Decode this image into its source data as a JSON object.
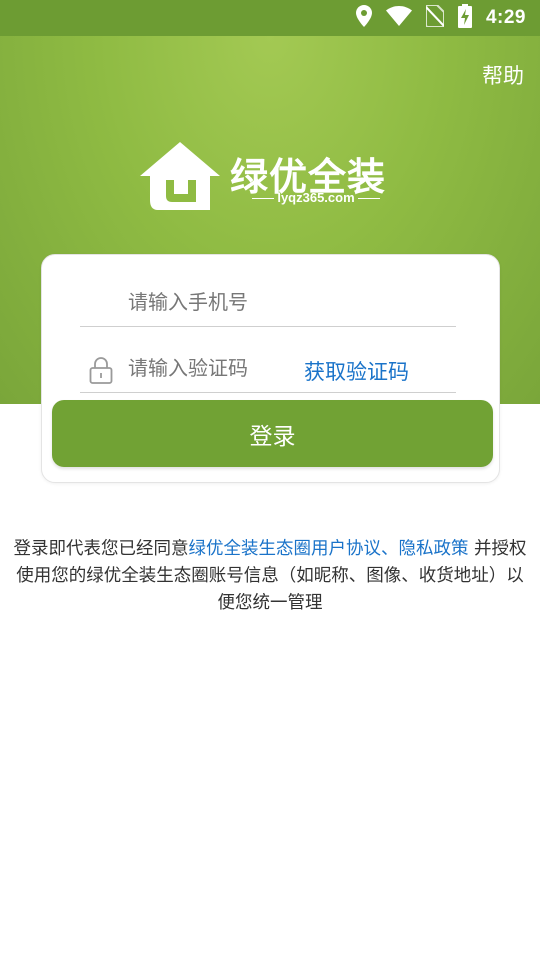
{
  "status_bar": {
    "time": "4:29",
    "icons": [
      "location-icon",
      "wifi-icon",
      "no-sim-icon",
      "battery-charging-icon"
    ]
  },
  "header": {
    "help_label": "帮助"
  },
  "logo": {
    "brand_name": "绿优全装",
    "domain": "lyqz365.com"
  },
  "form": {
    "phone_placeholder": "请输入手机号",
    "code_placeholder": "请输入验证码",
    "get_code_label": "获取验证码",
    "login_label": "登录"
  },
  "agreement": {
    "prefix": "登录即代表您已经同意",
    "user_agreement_link": "绿优全装生态圈用户协议",
    "separator": "、",
    "privacy_link": "隐私政策",
    "suffix": " 并授权使用您的绿优全装生态圈账号信息（如昵称、图像、收货地址）以便您统一管理"
  },
  "colors": {
    "status_bar": "#6d9c33",
    "hero_green": "#8fbb43",
    "button_green": "#71a234",
    "link_blue": "#1a73c9"
  }
}
